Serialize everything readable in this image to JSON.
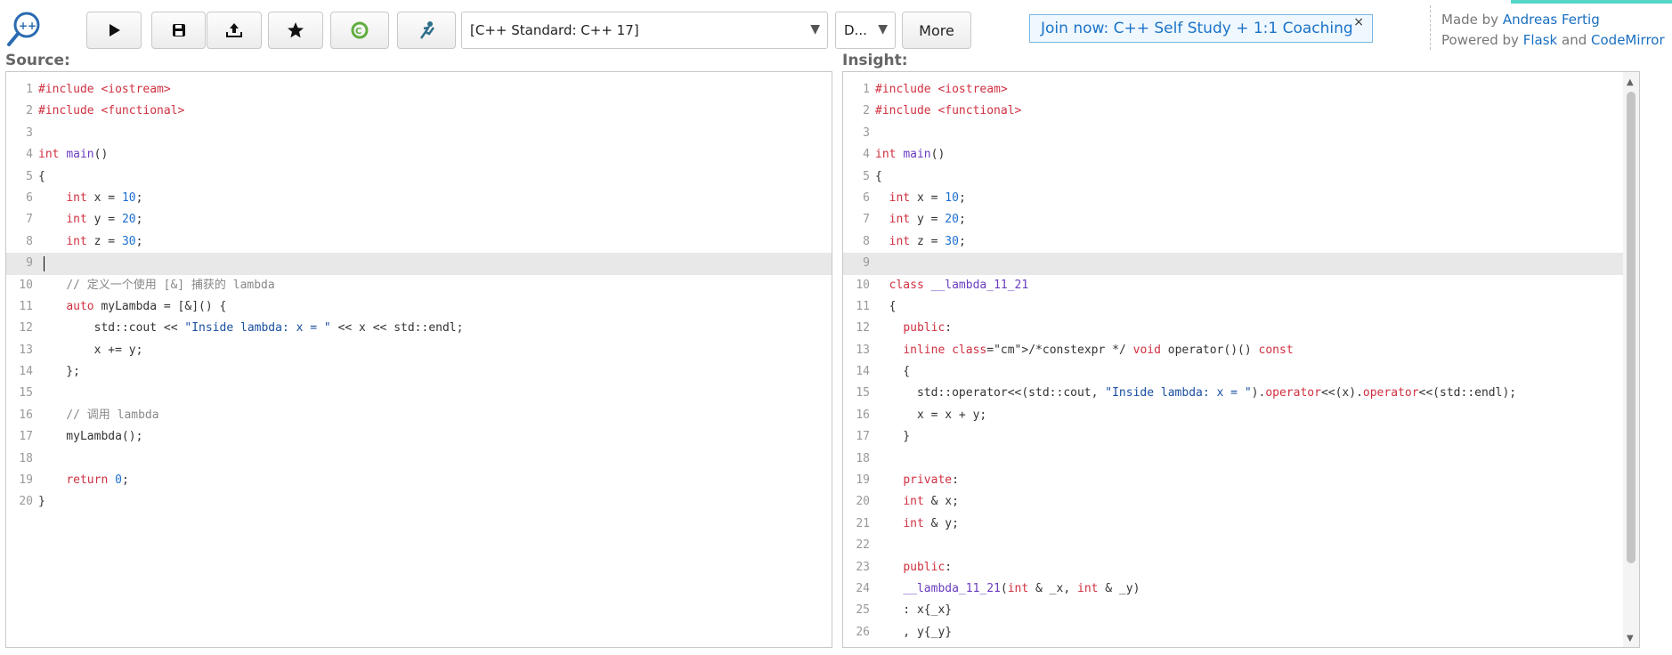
{
  "toolbar": {
    "standard": "[C++ Standard: C++ 17]",
    "alt_select": "D...",
    "more_label": "More"
  },
  "promo": {
    "text": "Join now: C++ Self Study + 1:1 Coaching",
    "close": "×"
  },
  "credits": {
    "made_by": "Made by",
    "author": "Andreas Fertig",
    "powered_by": "Powered by",
    "flask": "Flask",
    "and": "and",
    "codemirror": "CodeMirror"
  },
  "source": {
    "title": "Source:",
    "lines": [
      "#include <iostream>",
      "#include <functional>",
      "",
      "int main()",
      "{",
      "    int x = 10;",
      "    int y = 20;",
      "    int z = 30;",
      "",
      "    // 定义一个使用 [&] 捕获的 lambda",
      "    auto myLambda = [&]() {",
      "        std::cout << \"Inside lambda: x = \" << x << std::endl;",
      "        x += y;",
      "    };",
      "",
      "    // 调用 lambda",
      "    myLambda();",
      "",
      "    return 0;",
      "}"
    ]
  },
  "insight": {
    "title": "Insight:",
    "lines": [
      "#include <iostream>",
      "#include <functional>",
      "",
      "int main()",
      "{",
      "  int x = 10;",
      "  int y = 20;",
      "  int z = 30;",
      "",
      "  class __lambda_11_21",
      "  {",
      "    public:",
      "    inline /*constexpr */ void operator()() const",
      "    {",
      "      std::operator<<(std::cout, \"Inside lambda: x = \").operator<<(x).operator<<(std::endl);",
      "      x = x + y;",
      "    }",
      "",
      "    private:",
      "    int & x;",
      "    int & y;",
      "",
      "    public:",
      "    __lambda_11_21(int & _x, int & _y)",
      "    : x{_x}",
      "    , y{_y}"
    ]
  }
}
